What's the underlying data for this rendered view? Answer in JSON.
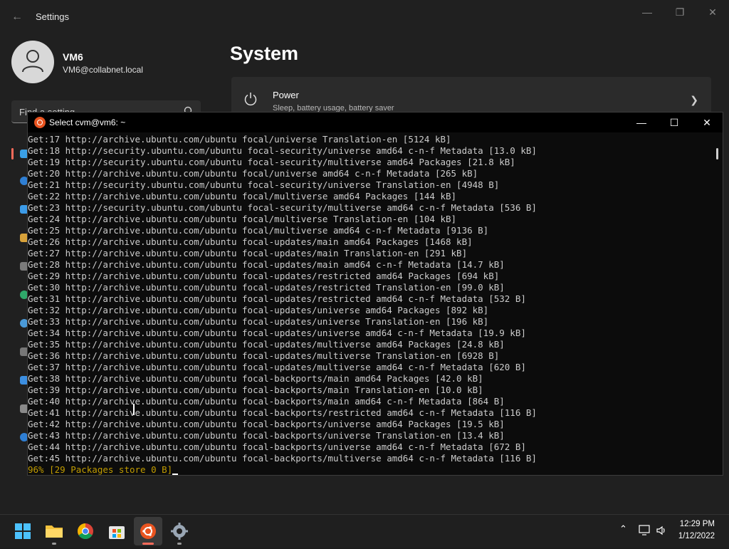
{
  "settings": {
    "title": "Settings",
    "user": {
      "name": "VM6",
      "email": "VM6@collabnet.local"
    },
    "search_placeholder": "Find a setting",
    "page_title": "System",
    "power": {
      "label": "Power",
      "subtitle": "Sleep, battery usage, battery saver"
    }
  },
  "terminal": {
    "title": "Select cvm@vm6: ~",
    "lines": [
      "Get:17 http://archive.ubuntu.com/ubuntu focal/universe Translation-en [5124 kB]",
      "Get:18 http://security.ubuntu.com/ubuntu focal-security/universe amd64 c-n-f Metadata [13.0 kB]",
      "Get:19 http://security.ubuntu.com/ubuntu focal-security/multiverse amd64 Packages [21.8 kB]",
      "Get:20 http://archive.ubuntu.com/ubuntu focal/universe amd64 c-n-f Metadata [265 kB]",
      "Get:21 http://security.ubuntu.com/ubuntu focal-security/universe Translation-en [4948 B]",
      "Get:22 http://archive.ubuntu.com/ubuntu focal/multiverse amd64 Packages [144 kB]",
      "Get:23 http://security.ubuntu.com/ubuntu focal-security/multiverse amd64 c-n-f Metadata [536 B]",
      "Get:24 http://archive.ubuntu.com/ubuntu focal/multiverse Translation-en [104 kB]",
      "Get:25 http://archive.ubuntu.com/ubuntu focal/multiverse amd64 c-n-f Metadata [9136 B]",
      "Get:26 http://archive.ubuntu.com/ubuntu focal-updates/main amd64 Packages [1468 kB]",
      "Get:27 http://archive.ubuntu.com/ubuntu focal-updates/main Translation-en [291 kB]",
      "Get:28 http://archive.ubuntu.com/ubuntu focal-updates/main amd64 c-n-f Metadata [14.7 kB]",
      "Get:29 http://archive.ubuntu.com/ubuntu focal-updates/restricted amd64 Packages [694 kB]",
      "Get:30 http://archive.ubuntu.com/ubuntu focal-updates/restricted Translation-en [99.0 kB]",
      "Get:31 http://archive.ubuntu.com/ubuntu focal-updates/restricted amd64 c-n-f Metadata [532 B]",
      "Get:32 http://archive.ubuntu.com/ubuntu focal-updates/universe amd64 Packages [892 kB]",
      "Get:33 http://archive.ubuntu.com/ubuntu focal-updates/universe Translation-en [196 kB]",
      "Get:34 http://archive.ubuntu.com/ubuntu focal-updates/universe amd64 c-n-f Metadata [19.9 kB]",
      "Get:35 http://archive.ubuntu.com/ubuntu focal-updates/multiverse amd64 Packages [24.8 kB]",
      "Get:36 http://archive.ubuntu.com/ubuntu focal-updates/multiverse Translation-en [6928 B]",
      "Get:37 http://archive.ubuntu.com/ubuntu focal-updates/multiverse amd64 c-n-f Metadata [620 B]",
      "Get:38 http://archive.ubuntu.com/ubuntu focal-backports/main amd64 Packages [42.0 kB]",
      "Get:39 http://archive.ubuntu.com/ubuntu focal-backports/main Translation-en [10.0 kB]",
      "Get:40 http://archive.ubuntu.com/ubuntu focal-backports/main amd64 c-n-f Metadata [864 B]",
      "Get:41 http://archive.ubuntu.com/ubuntu focal-backports/restricted amd64 c-n-f Metadata [116 B]",
      "Get:42 http://archive.ubuntu.com/ubuntu focal-backports/universe amd64 Packages [19.5 kB]",
      "Get:43 http://archive.ubuntu.com/ubuntu focal-backports/universe Translation-en [13.4 kB]",
      "Get:44 http://archive.ubuntu.com/ubuntu focal-backports/universe amd64 c-n-f Metadata [672 B]",
      "Get:45 http://archive.ubuntu.com/ubuntu focal-backports/multiverse amd64 c-n-f Metadata [116 B]"
    ],
    "progress_line": "96% [29 Packages store 0 B]"
  },
  "taskbar": {
    "apps": [
      "start-icon",
      "file-explorer-icon",
      "chrome-icon",
      "store-icon",
      "ubuntu-icon",
      "settings-icon"
    ],
    "clock": {
      "time": "12:29 PM",
      "date": "1/12/2022"
    }
  },
  "colors": {
    "accent": "#ff6b5a",
    "ubuntu": "#e95420",
    "terminal_bg": "#0c0c0c",
    "progress_text": "#c19c00"
  }
}
